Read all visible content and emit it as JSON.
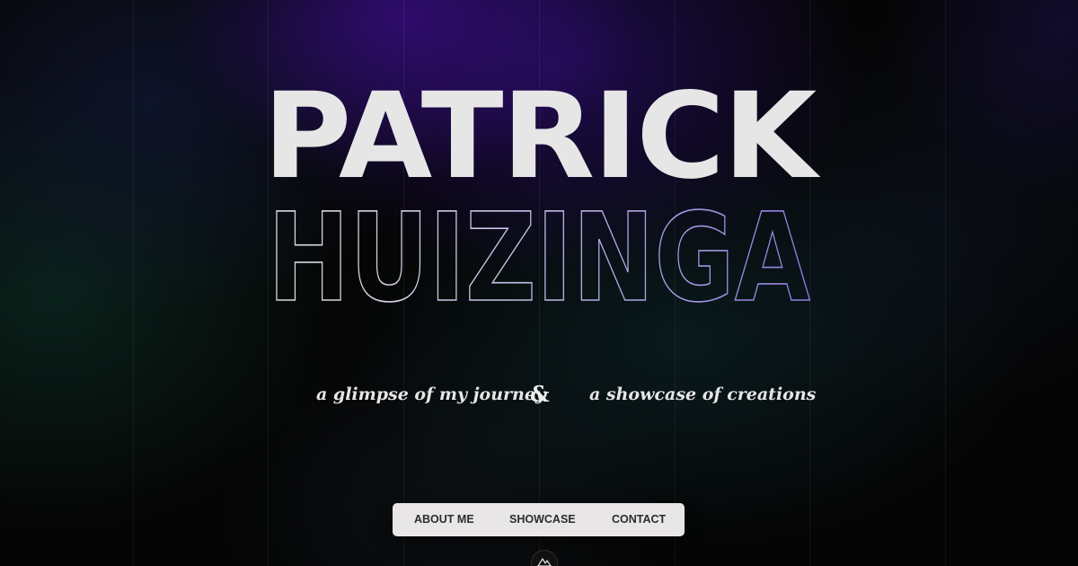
{
  "hero": {
    "first_name": "PATRICK",
    "last_name": "HUIZINGA"
  },
  "taglines": {
    "left": "a glimpse of my journey",
    "separator": "&",
    "right": "a showcase of creations"
  },
  "nav": {
    "items": [
      {
        "label": "ABOUT ME"
      },
      {
        "label": "SHOWCASE"
      },
      {
        "label": "CONTACT"
      }
    ]
  },
  "logo": {
    "icon": "mountain-logo-icon"
  },
  "colors": {
    "background": "#050505",
    "heading_fill": "#e6e6e6",
    "outline_gradient_start": "#d8d8d8",
    "outline_gradient_end": "#8f7de0",
    "nav_background": "#e8e6e6",
    "nav_text": "#2c2c2c"
  }
}
